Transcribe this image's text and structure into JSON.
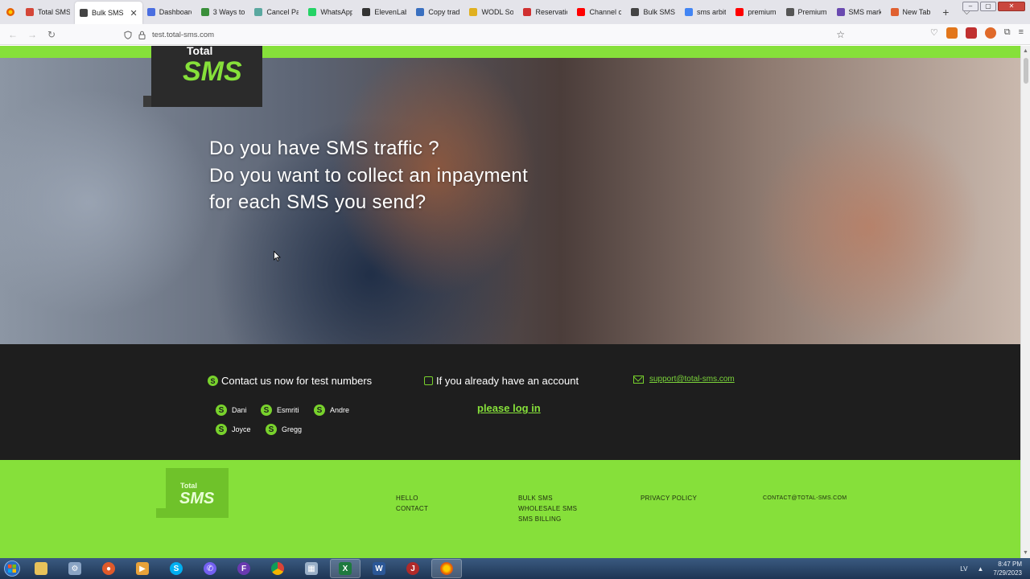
{
  "browser": {
    "tabs": [
      {
        "label": "Total SMS",
        "color": "#d44638"
      },
      {
        "label": "Bulk SMS",
        "color": "#444444",
        "active": true
      },
      {
        "label": "Dashboard",
        "color": "#4a6ee0"
      },
      {
        "label": "3 Ways to",
        "color": "#3a8f3a"
      },
      {
        "label": "Cancel Pa",
        "color": "#5aa8a0"
      },
      {
        "label": "WhatsApp",
        "color": "#25d366"
      },
      {
        "label": "ElevenLab",
        "color": "#333333"
      },
      {
        "label": "Copy trad",
        "color": "#3a70c0"
      },
      {
        "label": "WODL Sol",
        "color": "#e0b020"
      },
      {
        "label": "Reservatio",
        "color": "#d03030"
      },
      {
        "label": "Channel c",
        "color": "#ff0000"
      },
      {
        "label": "Bulk SMS",
        "color": "#444444"
      },
      {
        "label": "sms arbit",
        "color": "#4285f4"
      },
      {
        "label": "premium",
        "color": "#ff0000"
      },
      {
        "label": "Premium",
        "color": "#555555"
      },
      {
        "label": "SMS mark",
        "color": "#6a4ab0"
      },
      {
        "label": "New Tab",
        "color": "#e06030"
      }
    ],
    "url": "test.total-sms.com"
  },
  "logo": {
    "line1": "Total",
    "line2": "SMS"
  },
  "hero": {
    "line1": "Do you have SMS traffic ?",
    "line2": "Do you want to collect an inpayment",
    "line3": "for each SMS you send?"
  },
  "contact": {
    "test_numbers_heading": "Contact us now for test numbers",
    "account_heading": "If you already have an account",
    "login_link": "please log in",
    "email": "support@total-sms.com",
    "people": [
      "Dani",
      "Esmriti",
      "Andre",
      "Joyce",
      "Gregg"
    ],
    "accent": "#86e03a"
  },
  "footer": {
    "logo": {
      "line1": "Total",
      "line2": "SMS"
    },
    "col1": [
      "HELLO",
      "CONTACT"
    ],
    "col2": [
      "BULK SMS",
      "WHOLESALE SMS",
      "SMS BILLING"
    ],
    "col3": [
      "PRIVACY POLICY"
    ],
    "col4": [
      "CONTACT@TOTAL-SMS.COM"
    ],
    "background": "#86e03a"
  },
  "taskbar": {
    "lang": "LV",
    "time": "8:47 PM",
    "date": "7/29/2023"
  }
}
